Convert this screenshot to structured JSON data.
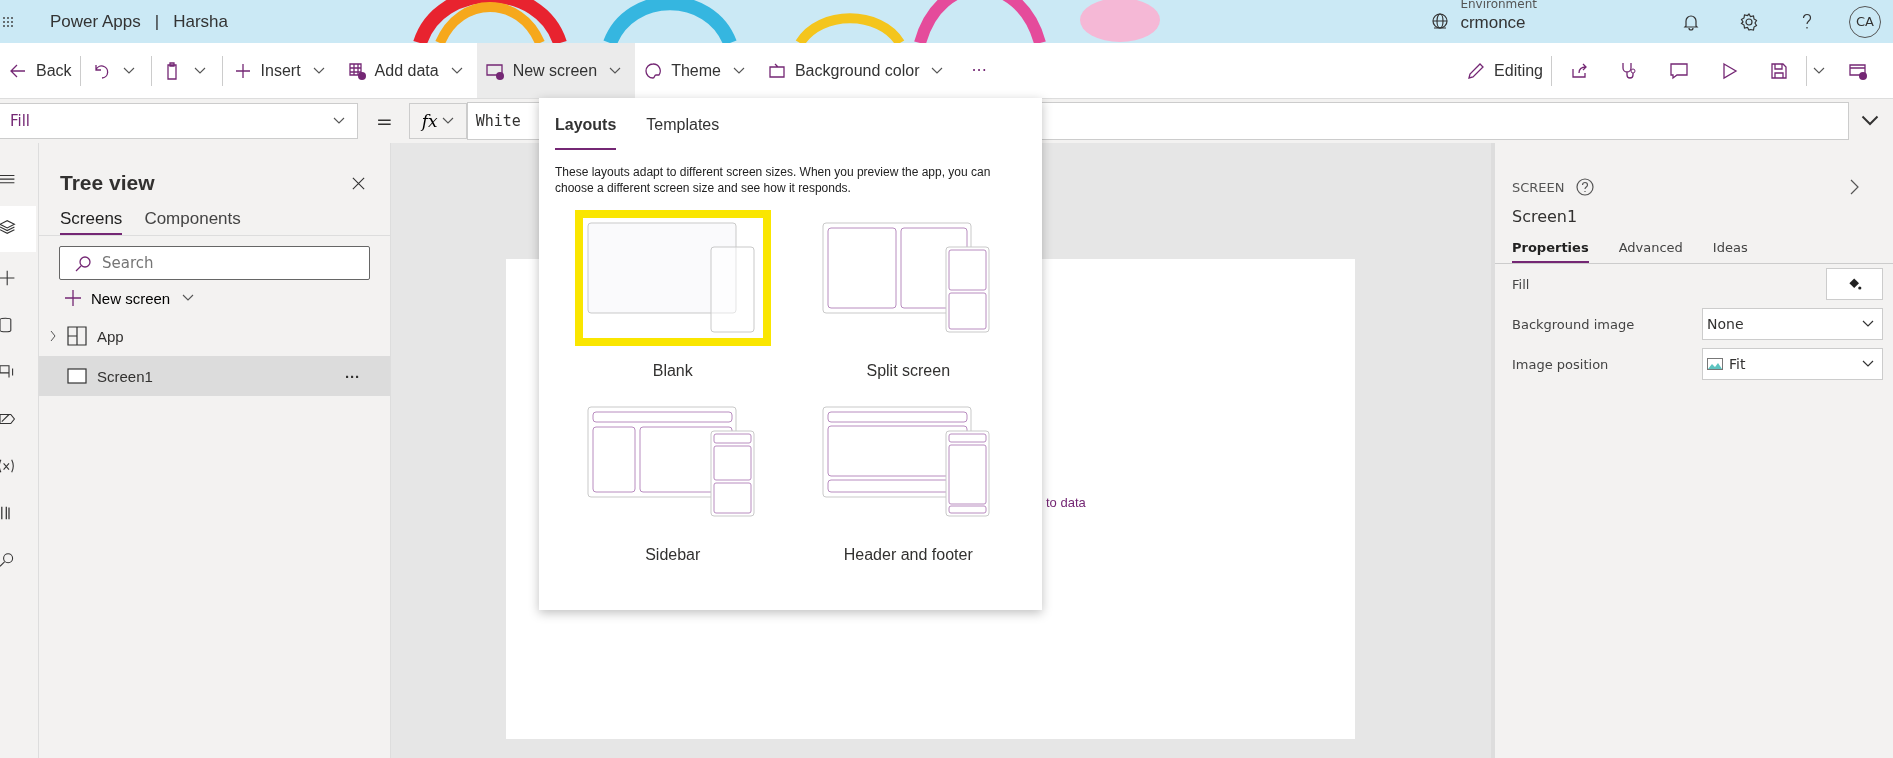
{
  "header": {
    "app_name": "Power Apps",
    "separator": "|",
    "app_title": "Harsha",
    "environment_label": "Environment",
    "environment": "crmonce",
    "avatar": "CA"
  },
  "command_bar": {
    "items": [
      {
        "kind": "back",
        "label": "Back",
        "selected": false
      },
      {
        "kind": "undo",
        "selected": false
      },
      {
        "kind": "paste",
        "selected": false
      },
      {
        "kind": "insert",
        "label": "Insert",
        "selected": false
      },
      {
        "kind": "add-data",
        "label": "Add data",
        "selected": false
      },
      {
        "kind": "new-screen",
        "label": "New screen",
        "selected": true
      },
      {
        "kind": "theme",
        "label": "Theme",
        "selected": false
      },
      {
        "kind": "background",
        "label": "Background color",
        "selected": false
      }
    ],
    "more": "···",
    "editing": "Editing"
  },
  "formula_bar": {
    "property": "Fill",
    "equals": "=",
    "fx": "fx",
    "formula": "White"
  },
  "tree_view": {
    "title": "Tree view",
    "tabs": [
      {
        "label": "Screens",
        "selected": true
      },
      {
        "label": "Components",
        "selected": false
      }
    ],
    "search": {
      "placeholder": "Search"
    },
    "new_screen": "New screen",
    "nodes": [
      {
        "kind": "app",
        "label": "App",
        "selected": false,
        "expanded": false
      },
      {
        "kind": "screen",
        "label": "Screen1",
        "selected": true
      }
    ],
    "more": "···"
  },
  "canvas": {
    "hint": "to data"
  },
  "new_screen_menu": {
    "tabs": [
      {
        "label": "Layouts",
        "selected": true
      },
      {
        "label": "Templates",
        "selected": false
      }
    ],
    "description": "These layouts adapt to different screen sizes. When you preview the app, you can choose a different screen size and see how it responds.",
    "layouts": [
      {
        "kind": "blank",
        "label": "Blank",
        "highlighted": true
      },
      {
        "kind": "split",
        "label": "Split screen",
        "highlighted": false
      },
      {
        "kind": "sidebar",
        "label": "Sidebar",
        "highlighted": false
      },
      {
        "kind": "header-footer",
        "label": "Header and footer",
        "highlighted": false
      }
    ]
  },
  "properties_panel": {
    "section": "SCREEN",
    "name": "Screen1",
    "tabs": [
      {
        "label": "Properties",
        "selected": true
      },
      {
        "label": "Advanced",
        "selected": false
      },
      {
        "label": "Ideas",
        "selected": false
      }
    ],
    "fields": [
      {
        "kind": "color",
        "label": "Fill"
      },
      {
        "kind": "select",
        "label": "Background image",
        "value": "None"
      },
      {
        "kind": "image-select",
        "label": "Image position",
        "value": "Fit"
      }
    ]
  }
}
